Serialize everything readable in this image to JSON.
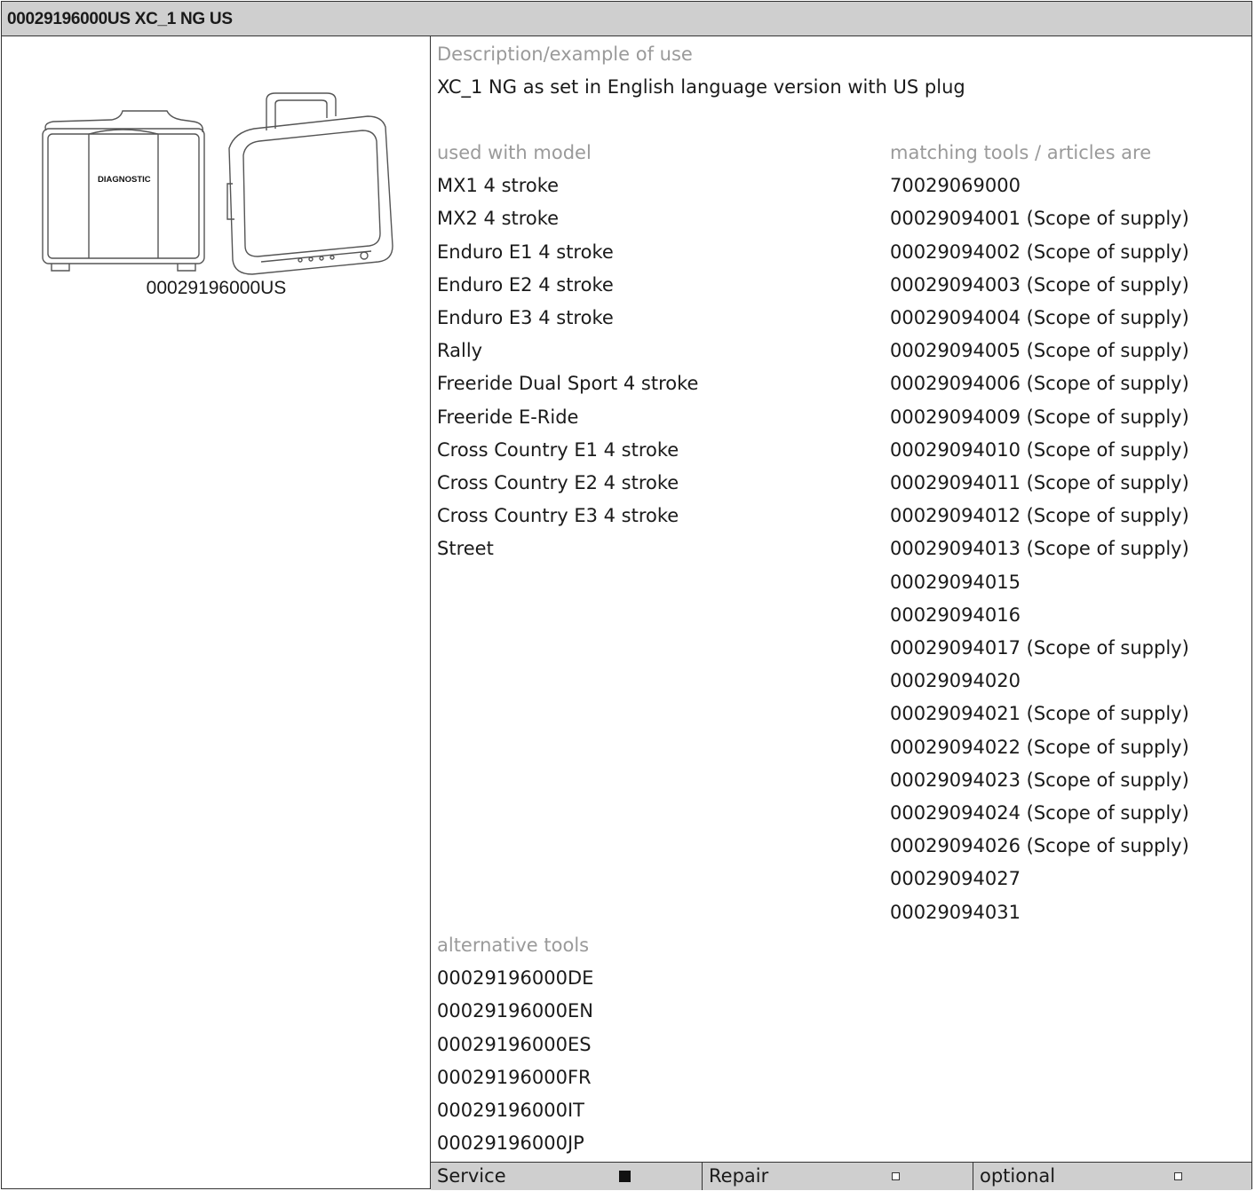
{
  "header": {
    "title": "00029196000US XC_1 NG US"
  },
  "image_panel": {
    "box_text": "DIAGNOSTIC",
    "caption": "00029196000US"
  },
  "description": {
    "label": "Description/example of use",
    "text": "XC_1 NG as set in English language version with US plug"
  },
  "models": {
    "label": "used with model",
    "items": [
      "MX1 4 stroke",
      "MX2 4 stroke",
      "Enduro E1 4 stroke",
      "Enduro E2 4 stroke",
      "Enduro E3 4 stroke",
      "Rally",
      "Freeride Dual Sport 4 stroke",
      "Freeride E-Ride",
      "Cross Country E1 4 stroke",
      "Cross Country E2 4 stroke",
      "Cross Country E3 4 stroke",
      "Street"
    ]
  },
  "matching_tools": {
    "label": "matching tools / articles are",
    "items": [
      "70029069000",
      "00029094001 (Scope of supply)",
      "00029094002 (Scope of supply)",
      "00029094003 (Scope of supply)",
      "00029094004 (Scope of supply)",
      "00029094005 (Scope of supply)",
      "00029094006 (Scope of supply)",
      "00029094009 (Scope of supply)",
      "00029094010 (Scope of supply)",
      "00029094011 (Scope of supply)",
      "00029094012 (Scope of supply)",
      "00029094013 (Scope of supply)",
      "00029094015",
      "00029094016",
      "00029094017 (Scope of supply)",
      "00029094020",
      "00029094021 (Scope of supply)",
      "00029094022 (Scope of supply)",
      "00029094023 (Scope of supply)",
      "00029094024 (Scope of supply)",
      "00029094026 (Scope of supply)",
      "00029094027",
      "00029094031"
    ]
  },
  "alternative_tools": {
    "label": "alternative tools",
    "items": [
      "00029196000DE",
      "00029196000EN",
      "00029196000ES",
      "00029196000FR",
      "00029196000IT",
      "00029196000JP"
    ]
  },
  "footer": {
    "service": {
      "label": "Service",
      "checked": true
    },
    "repair": {
      "label": "Repair",
      "checked": false
    },
    "optional": {
      "label": "optional",
      "checked": false
    }
  }
}
